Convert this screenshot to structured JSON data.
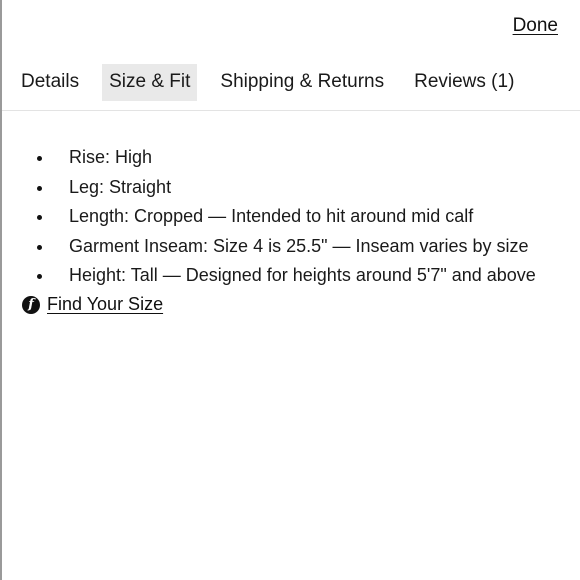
{
  "header": {
    "done_label": "Done"
  },
  "tabs": [
    {
      "label": "Details",
      "active": false
    },
    {
      "label": "Size & Fit",
      "active": true
    },
    {
      "label": "Shipping & Returns",
      "active": false
    },
    {
      "label": "Reviews (1)",
      "active": false
    }
  ],
  "size_fit": {
    "items": [
      "Rise: High",
      "Leg: Straight",
      "Length: Cropped — Intended to hit around mid calf",
      "Garment Inseam: Size 4 is 25.5\" — Inseam varies by size",
      "Height: Tall — Designed for heights around 5'7\" and above"
    ],
    "find_your_size": {
      "icon": "fit-logo-icon",
      "icon_glyph": "f",
      "label": "Find Your Size"
    }
  },
  "colors": {
    "active_tab_bg": "#e9e9e9",
    "text": "#1a1a1a",
    "divider": "#e3e3e3"
  }
}
